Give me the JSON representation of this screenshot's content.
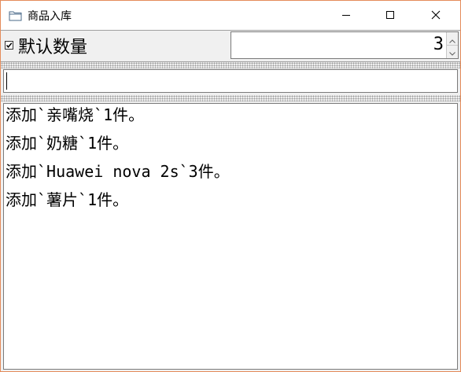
{
  "window": {
    "title": "商品入库",
    "title_icon": "folder-icon",
    "border_color": "#e58c5a"
  },
  "caption_buttons": {
    "minimize_icon": "minimize-icon",
    "maximize_icon": "maximize-icon",
    "close_icon": "close-icon"
  },
  "toolbar": {
    "default_quantity_checked": true,
    "default_quantity_label": "默认数量",
    "quantity_value": "3"
  },
  "input": {
    "value": "",
    "placeholder": ""
  },
  "log": {
    "lines": [
      "添加`亲嘴烧`1件。",
      "添加`奶糖`1件。",
      "添加`Huawei nova 2s`3件。",
      "添加`薯片`1件。"
    ]
  }
}
